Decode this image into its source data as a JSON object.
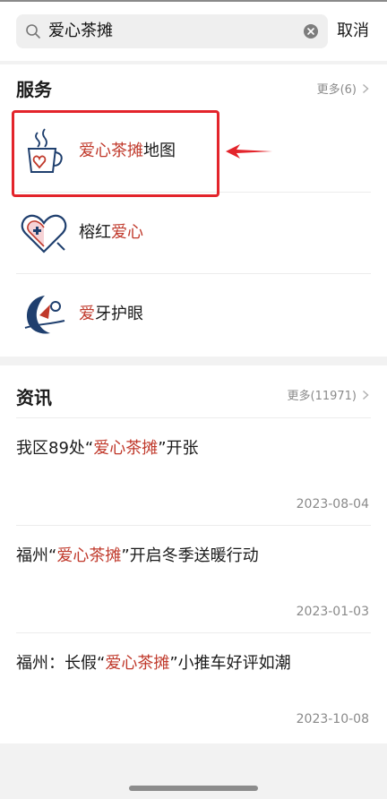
{
  "search": {
    "query": "爱心茶摊",
    "cancel_label": "取消"
  },
  "services": {
    "title": "服务",
    "more_label": "更多(6)",
    "items": [
      {
        "highlight": "爱心茶摊",
        "rest": "地图",
        "icon": "tea-cup-heart-icon"
      },
      {
        "prefix": "榕红",
        "highlight": "爱心",
        "icon": "heart-medical-icon"
      },
      {
        "highlight": "爱",
        "rest": "牙护眼",
        "icon": "moon-sail-logo-icon"
      }
    ]
  },
  "news": {
    "title": "资讯",
    "more_label": "更多(11971)",
    "items": [
      {
        "prefix": "我区89处“",
        "highlight": "爱心茶摊",
        "rest": "”开张",
        "date": "2023-08-04"
      },
      {
        "prefix": "福州“",
        "highlight": "爱心茶摊",
        "rest": "”开启冬季送暖行动",
        "date": "2023-01-03"
      },
      {
        "prefix": "福州：长假“",
        "highlight": "爱心茶摊",
        "rest": "”小推车好评如潮",
        "date": "2023-10-08"
      }
    ]
  },
  "colors": {
    "highlight_text": "#c0392b",
    "annotation_red": "#e3242b"
  }
}
